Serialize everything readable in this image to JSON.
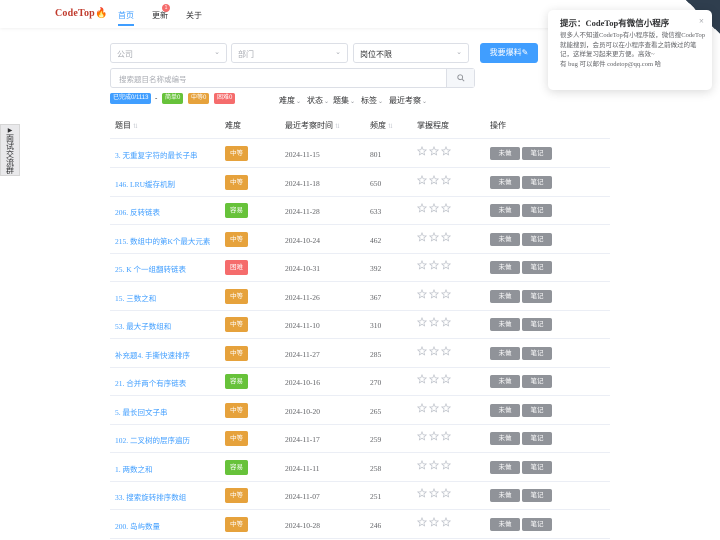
{
  "nav": {
    "logo_text": "CodeTop",
    "logo_icon": "flame-icon",
    "links": [
      {
        "label": "首页",
        "active": true
      },
      {
        "label": "更新",
        "badge": "1"
      },
      {
        "label": "关于"
      }
    ]
  },
  "side_tab": {
    "label": "面试交流群",
    "icon": "caret-right-icon"
  },
  "filters": {
    "company": {
      "placeholder": "公司"
    },
    "department": {
      "placeholder": "部门"
    },
    "position": {
      "value": "岗位不限"
    },
    "submit_label": "我要爆料"
  },
  "search": {
    "placeholder": "搜索题目名称或编号"
  },
  "progress_tags": [
    {
      "label": "已完成0/1113",
      "color": "#409eff"
    },
    {
      "label": "简单0",
      "color": "#67c23a"
    },
    {
      "label": "中等0",
      "color": "#e6a23c"
    },
    {
      "label": "困难0",
      "color": "#f56c6c"
    }
  ],
  "filter_links": [
    "难度",
    "状态",
    "题集",
    "标签",
    "最近考察"
  ],
  "table": {
    "headers": [
      "题目",
      "难度",
      "最近考察时间",
      "频度",
      "掌握程度",
      "操作"
    ],
    "action_labels": {
      "status": "未做",
      "note": "笔记"
    },
    "rows": [
      {
        "title": "3. 无重复字符的最长子串",
        "difficulty": "中等",
        "date": "2024-11-15",
        "freq": "801"
      },
      {
        "title": "146. LRU缓存机制",
        "difficulty": "中等",
        "date": "2024-11-18",
        "freq": "650"
      },
      {
        "title": "206. 反转链表",
        "difficulty": "容易",
        "date": "2024-11-28",
        "freq": "633"
      },
      {
        "title": "215. 数组中的第K个最大元素",
        "difficulty": "中等",
        "date": "2024-10-24",
        "freq": "462"
      },
      {
        "title": "25. K 个一组翻转链表",
        "difficulty": "困难",
        "date": "2024-10-31",
        "freq": "392"
      },
      {
        "title": "15. 三数之和",
        "difficulty": "中等",
        "date": "2024-11-26",
        "freq": "367"
      },
      {
        "title": "53. 最大子数组和",
        "difficulty": "中等",
        "date": "2024-11-10",
        "freq": "310"
      },
      {
        "title": "补充题4. 手撕快速排序",
        "difficulty": "中等",
        "date": "2024-11-27",
        "freq": "285"
      },
      {
        "title": "21. 合并两个有序链表",
        "difficulty": "容易",
        "date": "2024-10-16",
        "freq": "270"
      },
      {
        "title": "5. 最长回文子串",
        "difficulty": "中等",
        "date": "2024-10-20",
        "freq": "265"
      },
      {
        "title": "102. 二叉树的层序遍历",
        "difficulty": "中等",
        "date": "2024-11-17",
        "freq": "259"
      },
      {
        "title": "1. 两数之和",
        "difficulty": "容易",
        "date": "2024-11-11",
        "freq": "258"
      },
      {
        "title": "33. 搜索旋转排序数组",
        "difficulty": "中等",
        "date": "2024-11-07",
        "freq": "251"
      },
      {
        "title": "200. 岛屿数量",
        "difficulty": "中等",
        "date": "2024-10-28",
        "freq": "246"
      }
    ]
  },
  "difficulty_colors": {
    "容易": "#67c23a",
    "中等": "#e6a23c",
    "困难": "#f56c6c"
  },
  "notification": {
    "title": "提示：CodeTop有微信小程序",
    "body": "很多人不知道CodeTop有小程序版，微信搜CodeTop就能搜到，会员可以在小程序查看之前做过的笔记，这样复习起来更方便。高效~",
    "body2": "有 bug 可以邮件 codetop@qq.com 哈",
    "close": "×"
  }
}
